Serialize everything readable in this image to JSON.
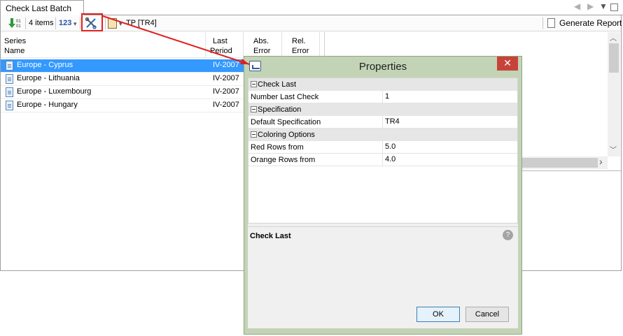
{
  "tab": {
    "title": "Check Last Batch"
  },
  "toolbar": {
    "items_count": "4 items",
    "numbers_label": "123",
    "spec_label": "TP [TR4]",
    "generate_report": "Generate Report"
  },
  "table": {
    "headers": [
      {
        "line1": "Series",
        "line2": "Name"
      },
      {
        "line1": "Last",
        "line2": "Period"
      },
      {
        "line1": "Abs.",
        "line2": "Error"
      },
      {
        "line1": "Rel.",
        "line2": "Error"
      }
    ],
    "rows": [
      {
        "name": "Europe - Cyprus",
        "period": "IV-2007",
        "selected": true
      },
      {
        "name": "Europe - Lithuania",
        "period": "IV-2007",
        "selected": false
      },
      {
        "name": "Europe - Luxembourg",
        "period": "IV-2007",
        "selected": false
      },
      {
        "name": "Europe - Hungary",
        "period": "IV-2007",
        "selected": false
      }
    ]
  },
  "dialog": {
    "title": "Properties",
    "close_glyph": "✕",
    "categories": [
      {
        "label": "Check Last",
        "props": [
          {
            "name": "Number Last Check",
            "value": "1"
          }
        ]
      },
      {
        "label": "Specification",
        "props": [
          {
            "name": "Default Specification",
            "value": "TR4"
          }
        ]
      },
      {
        "label": "Coloring Options",
        "props": [
          {
            "name": "Red Rows from",
            "value": "5.0"
          },
          {
            "name": "Orange Rows from",
            "value": "4.0"
          }
        ]
      }
    ],
    "help_title": "Check Last",
    "help_glyph": "?",
    "ok_label": "OK",
    "cancel_label": "Cancel"
  },
  "colors": {
    "selection": "#3399ff",
    "highlight_box": "#e02020",
    "dialog_frame": "#c3d4b6",
    "close_button": "#c7433a"
  },
  "glyphs": {
    "nav_left": "◀",
    "nav_right": "▶",
    "nav_menu": "▼",
    "dropdown": "▾",
    "scroll_up": "︿",
    "scroll_down": "﹀",
    "scroll_right": "›"
  }
}
